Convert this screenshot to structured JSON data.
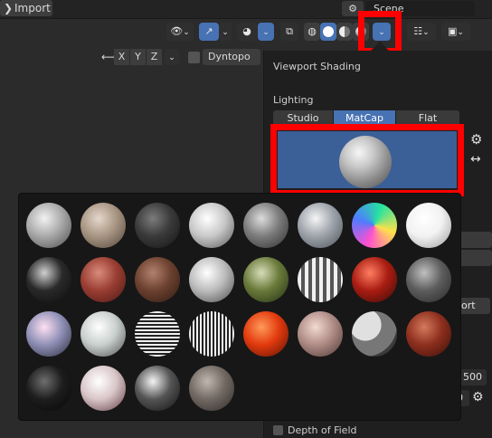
{
  "topbar": {
    "import_label": "Import",
    "scene_label": "Scene"
  },
  "toolbar": {
    "axes": [
      "X",
      "Y",
      "Z"
    ],
    "dyntopo_label": "Dyntopo"
  },
  "panel": {
    "title": "Viewport Shading",
    "lighting_label": "Lighting",
    "tabs": [
      "Studio",
      "MatCap",
      "Flat"
    ],
    "active_tab": "MatCap",
    "side_button_label": "ort",
    "value_1": "500",
    "value_2": "0",
    "depth_of_field_label": "Depth of Field"
  },
  "matcaps": [
    {
      "name": "basic-1",
      "colors": [
        "#f2f2f2",
        "#a9a9a9",
        "#4c4c4c"
      ]
    },
    {
      "name": "basic-2",
      "colors": [
        "#e4d7ca",
        "#a89583",
        "#4f4339"
      ]
    },
    {
      "name": "basic-dark",
      "colors": [
        "#7c7c7c",
        "#3a3a3a",
        "#141414"
      ]
    },
    {
      "name": "basic-side",
      "colors": [
        "#ffffff",
        "#c8c8c8",
        "#555555"
      ]
    },
    {
      "name": "ceramic-dark",
      "colors": [
        "#dcdcdc",
        "#7c7c7c",
        "#2d2d2d"
      ]
    },
    {
      "name": "ceramic-lightbulb",
      "colors": [
        "#f5f5f5",
        "#9da3aa",
        "#4b5056"
      ]
    },
    {
      "name": "check-normal",
      "colors": [
        "#ff4fd0",
        "#4f7bff",
        "#25e3a0"
      ]
    },
    {
      "name": "check-rim-light",
      "colors": [
        "#ffffff",
        "#f2f2f2",
        "#9a9a9a"
      ]
    },
    {
      "name": "check-rim-dark",
      "colors": [
        "#cfcfcf",
        "#2a2a2a",
        "#0c0c0c"
      ]
    },
    {
      "name": "clay-brown",
      "colors": [
        "#d98b7b",
        "#9a3e33",
        "#4d1813"
      ]
    },
    {
      "name": "clay-muddy",
      "colors": [
        "#b3816c",
        "#6c4130",
        "#2e1a12"
      ]
    },
    {
      "name": "clay-studio",
      "colors": [
        "#ffffff",
        "#bcbcbc",
        "#4b4b4b"
      ]
    },
    {
      "name": "jade",
      "colors": [
        "#d7ddb9",
        "#6a7a3a",
        "#233016"
      ]
    },
    {
      "name": "metal-anisotropic",
      "colors": [
        "#ffffff",
        "#8a8a8a",
        "#2c2c2c"
      ]
    },
    {
      "name": "metal-carpaint",
      "colors": [
        "#ff7e62",
        "#aa1d12",
        "#3a0b07"
      ]
    },
    {
      "name": "metal-lead",
      "colors": [
        "#c0c0c0",
        "#5d5d5d",
        "#272727"
      ]
    },
    {
      "name": "metal-shiny",
      "colors": [
        "#ffe0f2",
        "#8f90b6",
        "#2b2c3c"
      ]
    },
    {
      "name": "pearl",
      "colors": [
        "#ffffff",
        "#c9cfcc",
        "#4b4f4d"
      ]
    },
    {
      "name": "reflection-check-horizontal",
      "colors": [
        "#ffffff",
        "#9a9a9a",
        "#1e1e1e"
      ]
    },
    {
      "name": "reflection-check-vertical",
      "colors": [
        "#ffffff",
        "#9a9a9a",
        "#1e1e1e"
      ]
    },
    {
      "name": "resin",
      "colors": [
        "#ff9a5a",
        "#e23a0e",
        "#5a1104"
      ]
    },
    {
      "name": "skin",
      "colors": [
        "#f2dad2",
        "#b08c86",
        "#4b3532"
      ]
    },
    {
      "name": "toon",
      "colors": [
        "#d6d6d6",
        "#7a7a7a",
        "#3b3b3b"
      ]
    },
    {
      "name": "metal-red",
      "colors": [
        "#d47a5e",
        "#8e2f1e",
        "#3a0f08"
      ]
    },
    {
      "name": "black-glossy",
      "colors": [
        "#6e6e6e",
        "#1e1e1e",
        "#050505"
      ]
    },
    {
      "name": "pink-rim",
      "colors": [
        "#ffffff",
        "#d9c6c9",
        "#5f3a44"
      ]
    },
    {
      "name": "dark-rim",
      "colors": [
        "#f4f4f4",
        "#555555",
        "#101010"
      ]
    },
    {
      "name": "metal-matte",
      "colors": [
        "#bfb7b0",
        "#726963",
        "#2f2a27"
      ]
    }
  ],
  "colors": {
    "accent": "#4772b3",
    "highlight": "#ff0000"
  }
}
